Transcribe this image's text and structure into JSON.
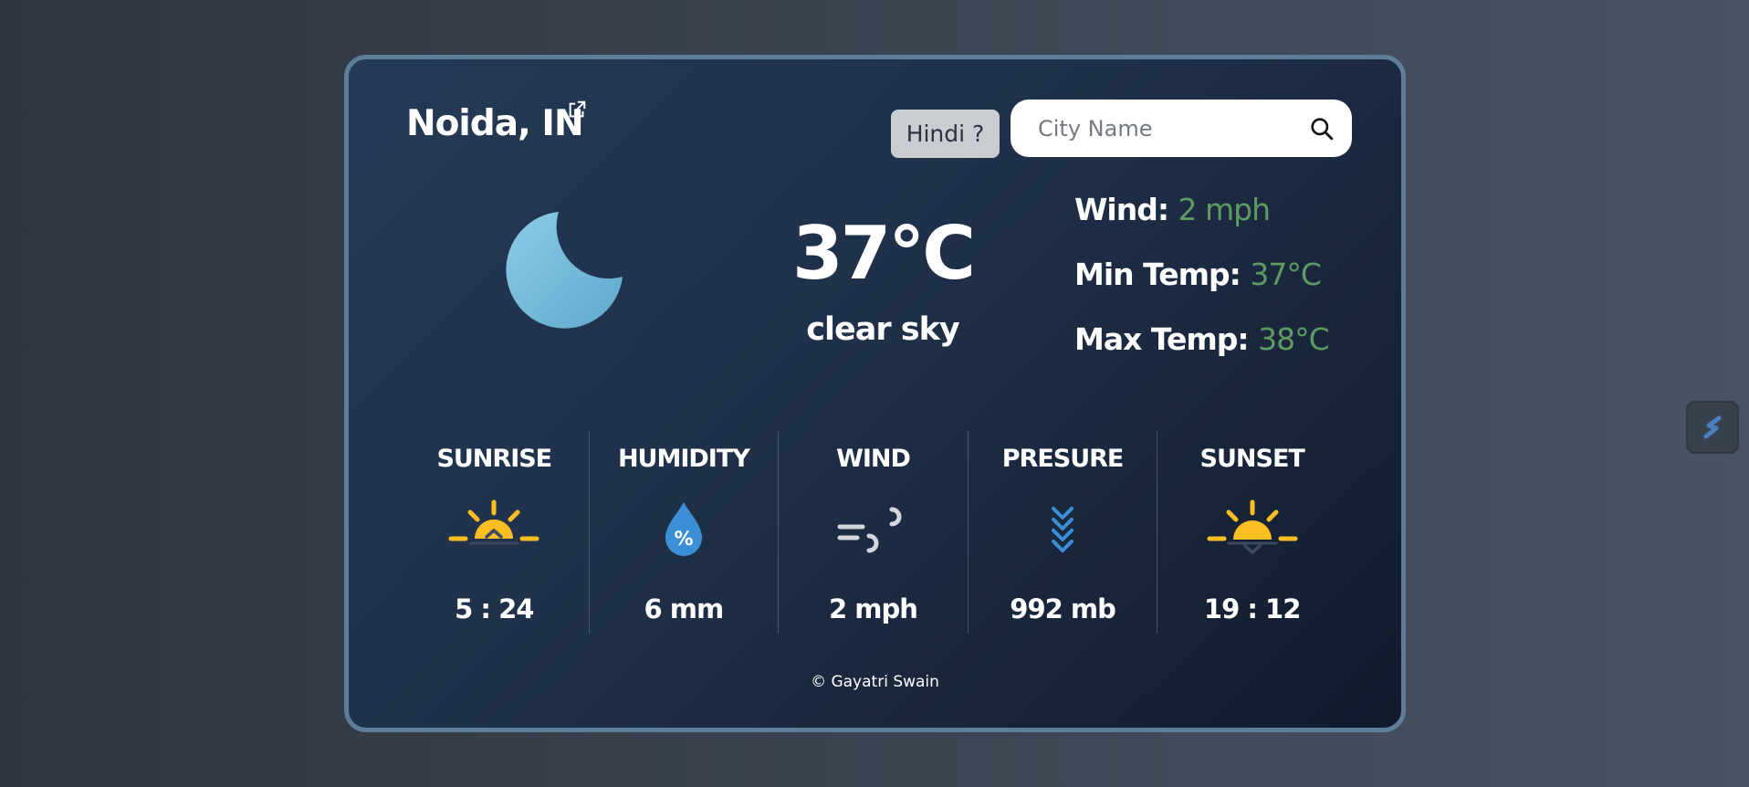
{
  "location": {
    "city": "Noida, IN"
  },
  "language_button": {
    "label": "Hindi ?"
  },
  "search": {
    "placeholder": "City Name"
  },
  "current": {
    "icon": "moon-icon",
    "temperature": "37°C",
    "description": "clear sky",
    "wind_label": "Wind:",
    "wind_value": "2 mph",
    "min_label": "Min Temp:",
    "min_value": "37°C",
    "max_label": "Max Temp:",
    "max_value": "38°C"
  },
  "stats": [
    {
      "label": "SUNRISE",
      "icon": "sunrise-icon",
      "value": "5 : 24"
    },
    {
      "label": "HUMIDITY",
      "icon": "humidity-icon",
      "value": "6 mm"
    },
    {
      "label": "WIND",
      "icon": "wind-icon",
      "value": "2 mph"
    },
    {
      "label": "PRESURE",
      "icon": "pressure-icon",
      "value": "992 mb"
    },
    {
      "label": "SUNSET",
      "icon": "sunset-icon",
      "value": "19 : 12"
    }
  ],
  "footer": {
    "text": "© Gayatri Swain"
  },
  "colors": {
    "accent_value": "#5e9b63",
    "card_border": "#5d7e98",
    "sun": "#fbbf24",
    "water": "#3b8fd6",
    "moon": "#7cc0dc"
  }
}
